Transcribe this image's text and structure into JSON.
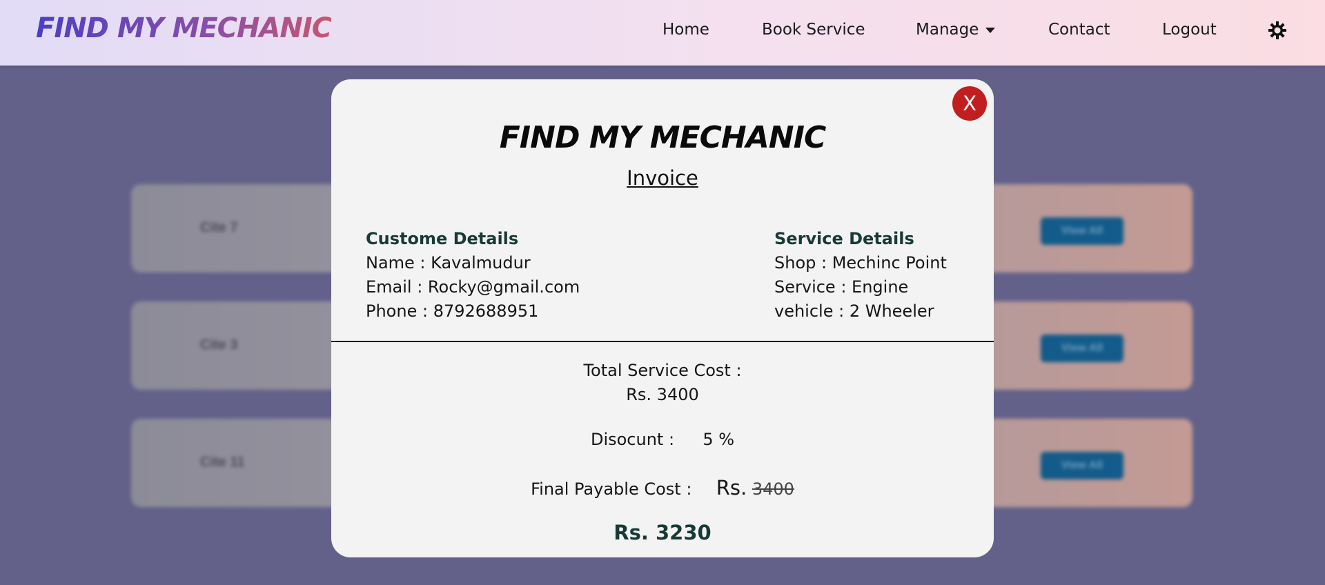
{
  "navbar": {
    "brand": "FIND MY MECHANIC",
    "items": [
      "Home",
      "Book Service",
      "Manage",
      "Contact",
      "Logout"
    ],
    "theme_icon": "sun-gear-icon"
  },
  "background_rows": [
    {
      "label": "Cite 7",
      "button": "View All"
    },
    {
      "label": "Cite 3",
      "button": "View All"
    },
    {
      "label": "Cite 11",
      "button": "View All"
    }
  ],
  "invoice": {
    "close_label": "X",
    "title": "FIND MY MECHANIC",
    "subtitle": "Invoice",
    "customer": {
      "heading": "Custome Details",
      "name": "Name : Kavalmudur",
      "email": "Email : Rocky@gmail.com",
      "phone": "Phone : 8792688951"
    },
    "service": {
      "heading": "Service Details",
      "shop": "Shop : Mechinc Point",
      "service": "Service : Engine",
      "vehicle": "vehicle : 2 Wheeler"
    },
    "total_label": "Total Service Cost :",
    "total_value": "Rs. 3400",
    "discount_label": "Disocunt :",
    "discount_value": "5 %",
    "final_label": "Final Payable Cost :",
    "final_currency": "Rs.",
    "final_struck": "3400",
    "final_value": "Rs. 3230"
  },
  "colors": {
    "close_button": "#c11f1f",
    "heading": "#173a36",
    "overlay": "#63618a"
  }
}
